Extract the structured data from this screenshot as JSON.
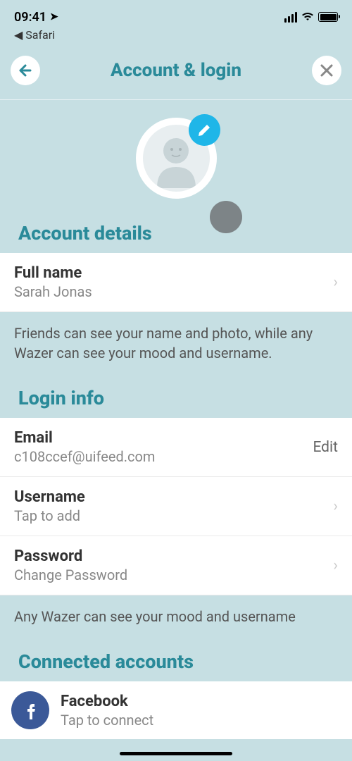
{
  "status": {
    "time": "09:41",
    "back_app": "Safari"
  },
  "header": {
    "title": "Account & login"
  },
  "sections": {
    "account_details": {
      "title": "Account details",
      "full_name_label": "Full name",
      "full_name_value": "Sarah Jonas",
      "hint": "Friends can see your name and photo, while any Wazer can see your mood and username."
    },
    "login_info": {
      "title": "Login info",
      "email_label": "Email",
      "email_value": "c108ccef@uifeed.com",
      "email_action": "Edit",
      "username_label": "Username",
      "username_value": "Tap to add",
      "password_label": "Password",
      "password_value": "Change Password",
      "hint": "Any Wazer can see your mood and username"
    },
    "connected": {
      "title": "Connected accounts",
      "facebook_label": "Facebook",
      "facebook_value": "Tap to connect"
    }
  }
}
